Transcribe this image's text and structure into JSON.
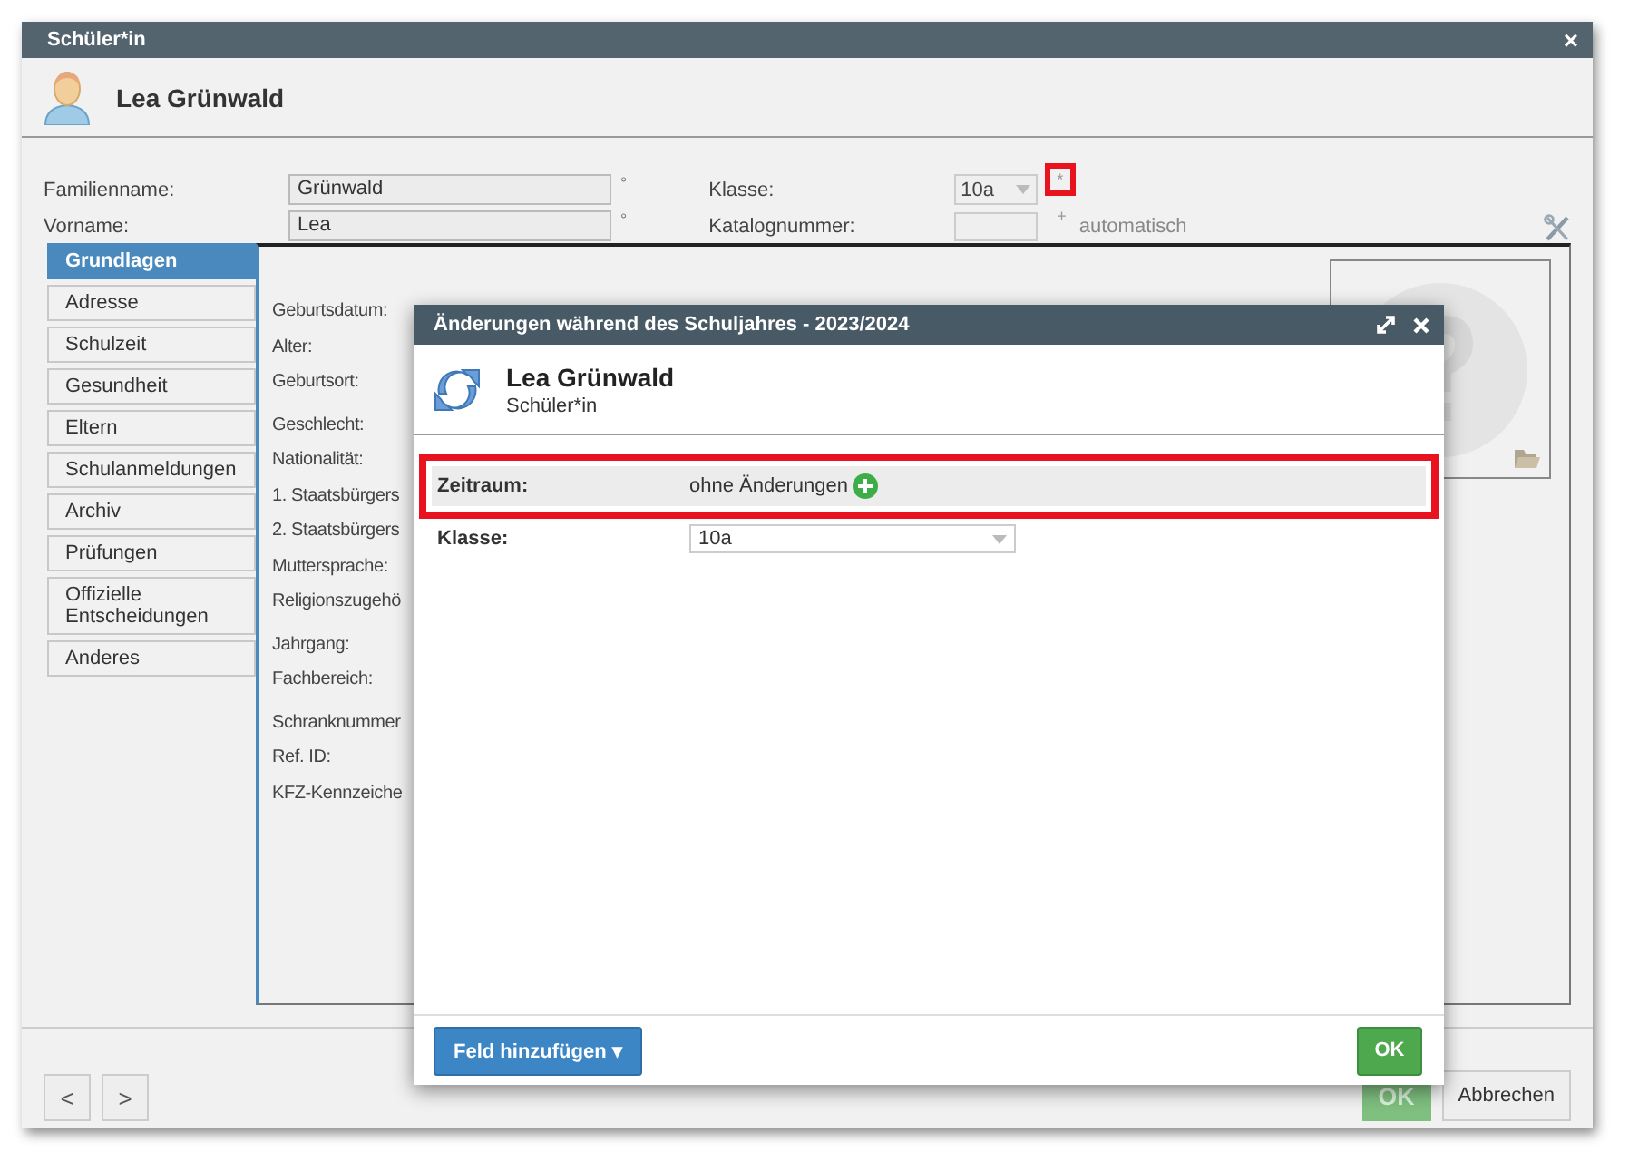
{
  "window": {
    "title": "Schüler*in",
    "close": "×"
  },
  "header": {
    "name": "Lea Grünwald"
  },
  "form": {
    "left": [
      {
        "label": "Familienname:",
        "value": "Grünwald",
        "marker": "°"
      },
      {
        "label": "Vorname:",
        "value": "Lea",
        "marker": "°"
      }
    ],
    "right": [
      {
        "label": "Klasse:",
        "kind": "select",
        "value": "10a",
        "marker": "*",
        "highlighted": true
      },
      {
        "label": "Katalognummer:",
        "kind": "input",
        "marker": "+",
        "note": "automatisch",
        "highlighted": false
      }
    ]
  },
  "tabs": [
    {
      "label": "Grundlagen",
      "selected": true
    },
    {
      "label": "Adresse",
      "selected": false
    },
    {
      "label": "Schulzeit",
      "selected": false
    },
    {
      "label": "Gesundheit",
      "selected": false
    },
    {
      "label": "Eltern",
      "selected": false
    },
    {
      "label": "Schulanmeldungen",
      "selected": false
    },
    {
      "label": "Archiv",
      "selected": false
    },
    {
      "label": "Prüfungen",
      "selected": false
    },
    {
      "label": "Offizielle Entscheidungen",
      "selected": false
    },
    {
      "label": "Anderes",
      "selected": false
    }
  ],
  "details": {
    "groups": [
      [
        "Geburtsdatum:",
        "Alter:",
        "Geburtsort:"
      ],
      [
        "Geschlecht:",
        "Nationalität:",
        "1. Staatsbürgers",
        "2. Staatsbürgers",
        "Muttersprache:",
        "Religionszugehö"
      ],
      [
        "Jahrgang:",
        "Fachbereich:"
      ],
      [
        "Schranknummer",
        "Ref. ID:",
        "KFZ-Kennzeiche"
      ]
    ]
  },
  "footer": {
    "prev": "<",
    "next": ">",
    "ok": "OK",
    "cancel": "Abbrechen"
  },
  "dialog": {
    "title": "Änderungen während des Schuljahres - 2023/2024",
    "name": "Lea Grünwald",
    "subtitle": "Schüler*in",
    "rows": [
      {
        "label": "Zeitraum:",
        "kind": "text",
        "value": "ohne Änderungen",
        "highlighted": true
      },
      {
        "label": "Klasse:",
        "kind": "select",
        "value": "10a",
        "highlighted": false
      }
    ],
    "add_button": "Feld hinzufügen ▾",
    "ok": "OK"
  }
}
